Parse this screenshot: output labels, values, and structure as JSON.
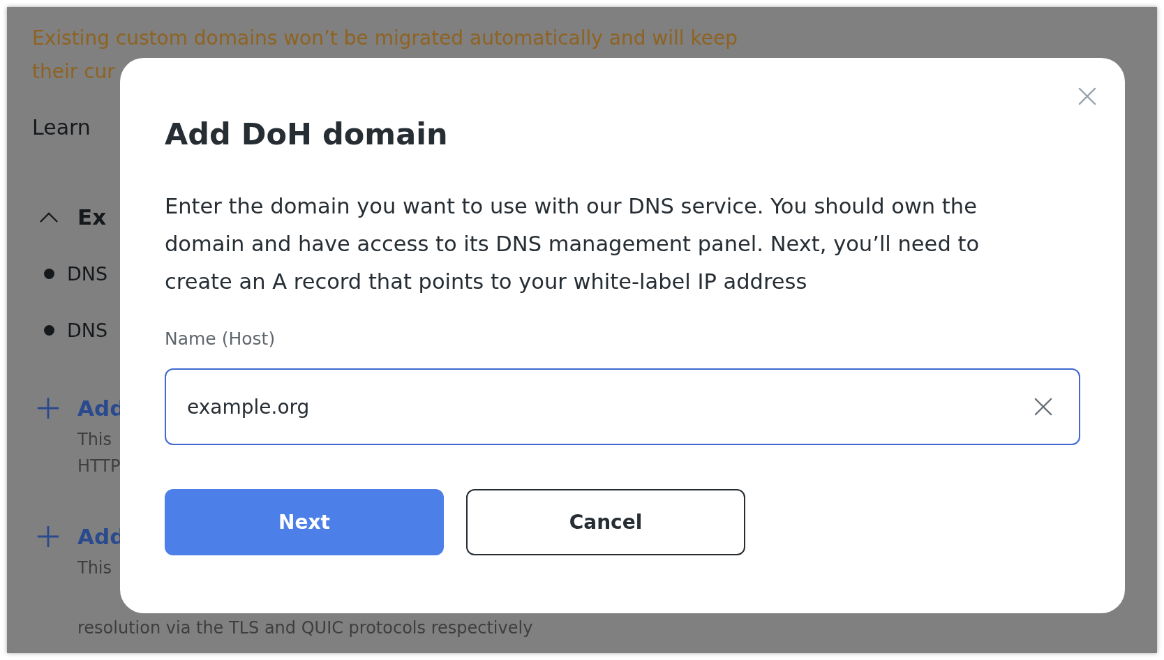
{
  "background_page": {
    "notice": [
      "Existing custom domains won’t be migrated automatically and will keep",
      "their cur"
    ],
    "learn_more": "Learn",
    "section": {
      "title": "Ex",
      "expanded": true,
      "items": [
        "DNS",
        "DNS"
      ]
    },
    "add_options": [
      {
        "title": "Add",
        "description": [
          "This",
          "HTTP"
        ]
      },
      {
        "title": "Add",
        "description": [
          "This",
          "resolution via the TLS and QUIC protocols respectively"
        ]
      }
    ]
  },
  "dialog": {
    "title": "Add DoH domain",
    "description": "Enter the domain you want to use with our DNS service. You should own the domain and have access to its DNS management panel. Next, you’ll need to create an A record that points to your white-label IP address",
    "field": {
      "label": "Name (Host)",
      "value": "example.org",
      "focused": true
    },
    "buttons": [
      {
        "label": "Next",
        "kind": "primary"
      },
      {
        "label": "Cancel",
        "kind": "secondary"
      }
    ]
  }
}
